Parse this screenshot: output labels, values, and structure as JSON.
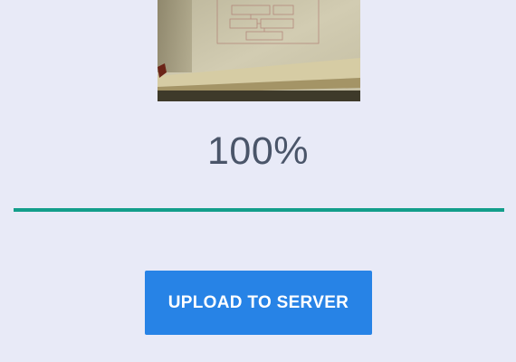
{
  "preview": {
    "alt": "photo of hand-drawn diagram"
  },
  "upload": {
    "percent_text": "100%",
    "progress_fraction": 1.0,
    "button_label": "UPLOAD TO SERVER"
  },
  "colors": {
    "background": "#E8EAF7",
    "progress_fill": "#139E8B",
    "progress_track": "#C8CDE6",
    "button": "#2783E6",
    "percent_text": "#4A5569"
  }
}
